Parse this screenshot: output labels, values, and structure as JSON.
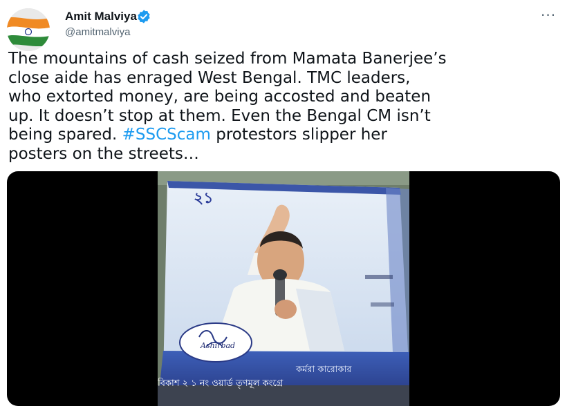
{
  "author": {
    "name": "Amit Malviya",
    "handle": "@amitmalviya",
    "verified": true
  },
  "menu": {
    "more_label": "···"
  },
  "tweet": {
    "lines": [
      "The mountains of cash seized from Mamata Banerjee’s",
      "close aide has enraged West Bengal. TMC leaders,",
      "who extorted money, are being accosted and beaten",
      "up. It doesn’t stop at them. Even the Bengal CM isn’t",
      "being spared. "
    ],
    "hashtag": "#SSCScam",
    "line5_after": " protestors slipper her",
    "line6": "posters on the streets…"
  },
  "media": {
    "poster_number": "২১",
    "logo_script": "Ashirbad",
    "poster_text_1": "বিকাশ ২ ১  নং ওয়ার্ড তৃণমূল কংগ্রে",
    "poster_text_2": "কর্মরা কারোকার"
  },
  "colors": {
    "link": "#1d9bf0",
    "verified_badge": "#1d9bf0",
    "text": "#0f1419",
    "secondary": "#536471"
  }
}
